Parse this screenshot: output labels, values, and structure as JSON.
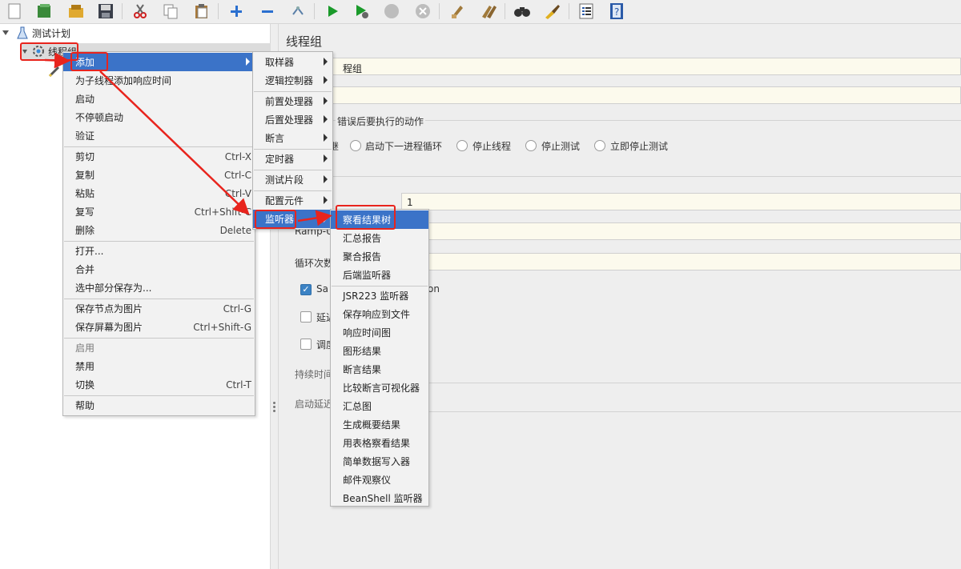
{
  "toolbar": {
    "icons": [
      "new-icon",
      "templates-icon",
      "open-icon",
      "save-icon",
      "cut-icon",
      "copy-icon",
      "paste-icon",
      "expand-icon",
      "collapse-icon",
      "toggle-icon",
      "start-icon",
      "start-no-pause-icon",
      "stop-icon",
      "shutdown-icon",
      "clear-icon",
      "clear-all-icon",
      "search-icon",
      "reset-search-icon",
      "function-helper-icon",
      "help-icon"
    ]
  },
  "tree": {
    "test_plan": "测试计划",
    "thread_group": "线程组"
  },
  "panel": {
    "title": "线程组",
    "name_value": "程组",
    "error_action_label": "错误后要执行的动作",
    "radio_cont": "继",
    "radio_start_next": "启动下一进程循环",
    "radio_stop_thread": "停止线程",
    "radio_stop_test": "停止测试",
    "radio_stop_now": "立即停止测试",
    "threads_value": "1",
    "rampup_label": "Ramp-U",
    "loop_label": "循环次数",
    "same_user_label": "Sa",
    "same_user_suffix": "on",
    "delay_label": "延迟",
    "scheduler_label": "调度",
    "duration_label": "持续时间",
    "startup_delay_label": "启动延迟"
  },
  "context_menu": [
    {
      "label": "添加",
      "shortcut": "",
      "submenu": true,
      "selected": true
    },
    {
      "label": "为子线程添加响应时间",
      "shortcut": ""
    },
    {
      "label": "启动",
      "shortcut": ""
    },
    {
      "label": "不停顿启动",
      "shortcut": ""
    },
    {
      "label": "验证",
      "shortcut": ""
    },
    {
      "label": "剪切",
      "shortcut": "Ctrl-X"
    },
    {
      "label": "复制",
      "shortcut": "Ctrl-C"
    },
    {
      "label": "粘贴",
      "shortcut": "Ctrl-V"
    },
    {
      "label": "复写",
      "shortcut": "Ctrl+Shift-C"
    },
    {
      "label": "删除",
      "shortcut": "Delete"
    },
    {
      "label": "打开...",
      "shortcut": ""
    },
    {
      "label": "合并",
      "shortcut": ""
    },
    {
      "label": "选中部分保存为...",
      "shortcut": ""
    },
    {
      "label": "保存节点为图片",
      "shortcut": "Ctrl-G"
    },
    {
      "label": "保存屏幕为图片",
      "shortcut": "Ctrl+Shift-G"
    },
    {
      "label": "启用",
      "shortcut": "",
      "disabled": true
    },
    {
      "label": "禁用",
      "shortcut": ""
    },
    {
      "label": "切换",
      "shortcut": "Ctrl-T"
    },
    {
      "label": "帮助",
      "shortcut": ""
    }
  ],
  "add_submenu": [
    {
      "label": "取样器"
    },
    {
      "label": "逻辑控制器"
    },
    {
      "label": "前置处理器"
    },
    {
      "label": "后置处理器"
    },
    {
      "label": "断言"
    },
    {
      "label": "定时器"
    },
    {
      "label": "测试片段"
    },
    {
      "label": "配置元件"
    },
    {
      "label": "监听器",
      "selected": true
    }
  ],
  "listener_submenu": [
    {
      "label": "察看结果树",
      "selected": true
    },
    {
      "label": "汇总报告"
    },
    {
      "label": "聚合报告"
    },
    {
      "label": "后端监听器"
    },
    {
      "label": "JSR223 监听器"
    },
    {
      "label": "保存响应到文件"
    },
    {
      "label": "响应时间图"
    },
    {
      "label": "图形结果"
    },
    {
      "label": "断言结果"
    },
    {
      "label": "比较断言可视化器"
    },
    {
      "label": "汇总图"
    },
    {
      "label": "生成概要结果"
    },
    {
      "label": "用表格察看结果"
    },
    {
      "label": "简单数据写入器"
    },
    {
      "label": "邮件观察仪"
    },
    {
      "label": "BeanShell 监听器"
    }
  ],
  "colors": {
    "selection": "#3b73c8",
    "annotation": "#e8241d",
    "field_bg": "#fcfaed"
  }
}
